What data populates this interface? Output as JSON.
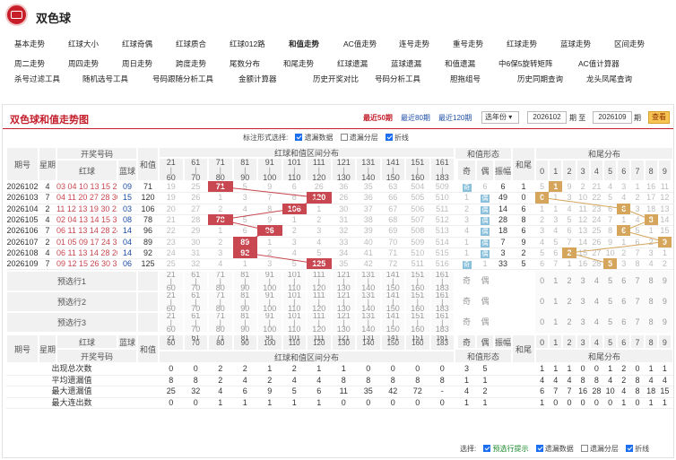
{
  "app": {
    "title": "双色球"
  },
  "nav": [
    "基本走势",
    "红球大小",
    "红球奇偶",
    "红球质合",
    "红球012路",
    "和值走势",
    "AC值走势",
    "连号走势",
    "重号走势",
    "红球走势",
    "蓝球走势",
    "区间走势",
    "周二走势",
    "周四走势",
    "周日走势",
    "跨度走势",
    "尾数分布",
    "和尾走势",
    "红球遗漏",
    "蓝球遗漏",
    "和值遗漏",
    "中6保5旋转矩阵",
    "AC值计算器",
    "杀号过滤工具",
    "随机选号工具",
    "号码跟随分析工具",
    "金额计算器",
    "历史开奖对比",
    "号码分析工具",
    "胆拖组号",
    "历史同期查询",
    "龙头凤尾查询"
  ],
  "panel": {
    "title": "双色球和值走势图",
    "recent_50": "最近50期",
    "recent_80": "最近80期",
    "recent_120": "最近120期",
    "select_label": "选年份",
    "from_issue": "2026102",
    "range_mid": "期  至",
    "to_issue": "2026109",
    "range_end": "期",
    "view_button": "查看"
  },
  "options": {
    "label": "标注形式选择:",
    "items": [
      "遗漏数据",
      "遗漏分层",
      "折线"
    ],
    "checked": [
      true,
      false,
      true
    ]
  },
  "headers": {
    "issue": "期号",
    "week": "星期",
    "draw": "开奖号码",
    "red": "红球",
    "blue": "蓝球",
    "sum": "和值",
    "zone": "红球和值区间分布",
    "form": "和值形态",
    "odd": "奇",
    "even": "偶",
    "amp": "振幅",
    "tail": "和尾",
    "tail_dist": "和尾分布"
  },
  "zones": [
    [
      "21",
      "60"
    ],
    [
      "61",
      "70"
    ],
    [
      "71",
      "80"
    ],
    [
      "81",
      "90"
    ],
    [
      "91",
      "100"
    ],
    [
      "101",
      "110"
    ],
    [
      "111",
      "120"
    ],
    [
      "121",
      "130"
    ],
    [
      "131",
      "140"
    ],
    [
      "141",
      "150"
    ],
    [
      "151",
      "160"
    ],
    [
      "161",
      "183"
    ]
  ],
  "tail_digits": [
    "0",
    "1",
    "2",
    "3",
    "4",
    "5",
    "6",
    "7",
    "8",
    "9"
  ],
  "rows": [
    {
      "issue": "2026102",
      "week": "4",
      "red": "03 04 10 13 15 26",
      "blue": "09",
      "sum": "71",
      "zone_cells": [
        "19",
        "25",
        "71",
        "5",
        "9",
        "6",
        "26",
        "36",
        "35",
        "63",
        "504",
        "509"
      ],
      "odd": "奇",
      "even": "6",
      "amp": "6",
      "tail": "1",
      "tail_cells": [
        "5",
        "1",
        "9",
        "2",
        "21",
        "4",
        "3",
        "1",
        "16",
        "11"
      ]
    },
    {
      "issue": "2026103",
      "week": "7",
      "red": "04 11 20 27 28 30",
      "blue": "15",
      "sum": "120",
      "zone_cells": [
        "19",
        "26",
        "1",
        "3",
        "7",
        "8",
        "120",
        "26",
        "36",
        "66",
        "505",
        "510"
      ],
      "odd": "1",
      "even": "偶",
      "amp": "49",
      "tail": "0",
      "tail_cells": [
        "0",
        "1",
        "3",
        "10",
        "22",
        "5",
        "4",
        "2",
        "17",
        "12"
      ]
    },
    {
      "issue": "2026104",
      "week": "2",
      "red": "11 12 13 19 30 21",
      "blue": "03",
      "sum": "106",
      "zone_cells": [
        "20",
        "27",
        "2",
        "4",
        "8",
        "106",
        "1",
        "30",
        "37",
        "67",
        "506",
        "511"
      ],
      "odd": "2",
      "even": "偶",
      "amp": "14",
      "tail": "6",
      "tail_cells": [
        "1",
        "1",
        "4",
        "11",
        "23",
        "6",
        "6",
        "3",
        "18",
        "13"
      ]
    },
    {
      "issue": "2026105",
      "week": "4",
      "red": "02 04 13 14 15 30",
      "blue": "08",
      "sum": "78",
      "zone_cells": [
        "21",
        "28",
        "78",
        "5",
        "9",
        "1",
        "2",
        "31",
        "38",
        "68",
        "507",
        "512"
      ],
      "odd": "3",
      "even": "偶",
      "amp": "28",
      "tail": "8",
      "tail_cells": [
        "2",
        "3",
        "5",
        "12",
        "24",
        "7",
        "1",
        "4",
        "8",
        "14"
      ]
    },
    {
      "issue": "2026106",
      "week": "7",
      "red": "06 11 13 14 28 24",
      "blue": "14",
      "sum": "96",
      "zone_cells": [
        "22",
        "29",
        "1",
        "6",
        "96",
        "2",
        "3",
        "32",
        "39",
        "69",
        "508",
        "513"
      ],
      "odd": "4",
      "even": "偶",
      "amp": "18",
      "tail": "6",
      "tail_cells": [
        "3",
        "4",
        "6",
        "13",
        "25",
        "8",
        "6",
        "5",
        "1",
        "15"
      ]
    },
    {
      "issue": "2026107",
      "week": "2",
      "red": "01 05 09 17 24 33",
      "blue": "04",
      "sum": "89",
      "zone_cells": [
        "23",
        "30",
        "2",
        "89",
        "1",
        "3",
        "4",
        "33",
        "40",
        "70",
        "509",
        "514"
      ],
      "odd": "1",
      "even": "偶",
      "amp": "7",
      "tail": "9",
      "tail_cells": [
        "4",
        "5",
        "7",
        "14",
        "26",
        "9",
        "1",
        "6",
        "2",
        "9"
      ]
    },
    {
      "issue": "2026108",
      "week": "4",
      "red": "06 11 13 14 28 20",
      "blue": "14",
      "sum": "92",
      "zone_cells": [
        "24",
        "31",
        "3",
        "92",
        "2",
        "4",
        "5",
        "34",
        "41",
        "71",
        "510",
        "515"
      ],
      "odd": "1",
      "even": "偶",
      "amp": "3",
      "tail": "2",
      "tail_cells": [
        "5",
        "6",
        "2",
        "15",
        "27",
        "10",
        "2",
        "7",
        "3",
        "1"
      ]
    },
    {
      "issue": "2026109",
      "week": "7",
      "red": "09 12 15 26 30 33",
      "blue": "06",
      "sum": "125",
      "zone_cells": [
        "25",
        "32",
        "4",
        "1",
        "3",
        "5",
        "125",
        "35",
        "42",
        "72",
        "511",
        "516"
      ],
      "odd": "奇",
      "even": "1",
      "amp": "33",
      "tail": "5",
      "tail_cells": [
        "6",
        "7",
        "1",
        "16",
        "28",
        "5",
        "3",
        "8",
        "4",
        "2"
      ]
    }
  ],
  "hit": [
    {
      "zone": 2,
      "tail": 1
    },
    {
      "zone": 6,
      "tail": 0
    },
    {
      "zone": 5,
      "tail": 6
    },
    {
      "zone": 2,
      "tail": 8
    },
    {
      "zone": 4,
      "tail": 6
    },
    {
      "zone": 3,
      "tail": 9
    },
    {
      "zone": 3,
      "tail": 2
    },
    {
      "zone": 6,
      "tail": 5
    }
  ],
  "preselect": [
    "预选行1",
    "预选行2",
    "预选行3"
  ],
  "form_labels": [
    "奇",
    "偶"
  ],
  "stats": [
    {
      "label": "出现总次数",
      "zones": [
        "0",
        "0",
        "2",
        "2",
        "1",
        "2",
        "1",
        "1",
        "0",
        "0",
        "0",
        "0"
      ],
      "form": [
        "3",
        "5"
      ],
      "tails": [
        "1",
        "1",
        "1",
        "0",
        "0",
        "1",
        "2",
        "0",
        "1",
        "1"
      ]
    },
    {
      "label": "平均遗漏值",
      "zones": [
        "8",
        "8",
        "2",
        "4",
        "2",
        "4",
        "4",
        "8",
        "8",
        "8",
        "8",
        "8"
      ],
      "form": [
        "1",
        "1"
      ],
      "tails": [
        "4",
        "4",
        "4",
        "8",
        "8",
        "4",
        "2",
        "8",
        "4",
        "4"
      ]
    },
    {
      "label": "最大遗漏值",
      "zones": [
        "25",
        "32",
        "4",
        "6",
        "9",
        "5",
        "6",
        "11",
        "35",
        "42",
        "72",
        "-"
      ],
      "form": [
        "4",
        "2"
      ],
      "tails": [
        "6",
        "7",
        "7",
        "16",
        "28",
        "10",
        "4",
        "8",
        "18",
        "15"
      ]
    },
    {
      "label": "最大连出数",
      "zones": [
        "0",
        "0",
        "1",
        "1",
        "1",
        "1",
        "1",
        "0",
        "0",
        "0",
        "0",
        "0"
      ],
      "form": [
        "1",
        "1"
      ],
      "tails": [
        "1",
        "0",
        "0",
        "0",
        "0",
        "0",
        "1",
        "0",
        "1",
        "1"
      ]
    }
  ],
  "footer": {
    "label": "选择:",
    "items": [
      "预选行提示",
      "遗漏数据",
      "遗漏分层",
      "折线"
    ],
    "checked": [
      true,
      true,
      false,
      true
    ]
  }
}
